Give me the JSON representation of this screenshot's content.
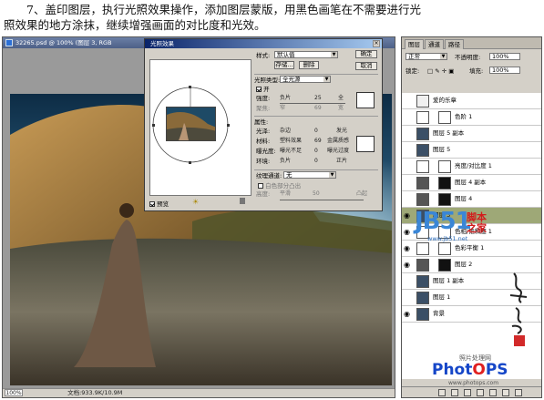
{
  "instruction": {
    "line1": "7、盖印图层，执行光照效果操作，添加图层蒙版，用黑色画笔在不需要进行光",
    "line2": "照效果的地方涂抹，继续增强画面的对比度和光效。"
  },
  "document": {
    "title": "32265.psd @ 100% (图层 3, RGB",
    "zoom": "100%",
    "doc_label": "文档:933.9K/10.9M"
  },
  "dialog": {
    "title": "光照效果",
    "ok": "确定",
    "cancel": "取消",
    "style_label": "样式:",
    "style_value": "默认值",
    "save": "存储...",
    "delete": "删除",
    "light_type_label": "光照类型:",
    "light_type_value": "全光源",
    "on_label": "开",
    "intensity_label": "强度:",
    "intensity_min": "负片",
    "intensity_value": "25",
    "intensity_max": "全",
    "focus_label": "聚焦:",
    "focus_min": "窄",
    "focus_value": "69",
    "focus_max": "宽",
    "properties_label": "属性:",
    "gloss_label": "光泽:",
    "gloss_min": "杂边",
    "gloss_value": "0",
    "gloss_max": "发光",
    "material_label": "材料:",
    "material_min": "塑料效果",
    "material_value": "69",
    "material_max": "金属质感",
    "exposure_label": "曝光度:",
    "exposure_min": "曝光不足",
    "exposure_value": "0",
    "exposure_max": "曝光过度",
    "ambience_label": "环境:",
    "ambience_min": "负片",
    "ambience_value": "0",
    "ambience_max": "正片",
    "texture_label": "纹理通道:",
    "texture_value": "无",
    "white_high_label": "白色部分凸出",
    "height_label": "高度:",
    "height_min": "平滑",
    "height_value": "50",
    "height_max": "凸起",
    "preview_label": "预览"
  },
  "layers_panel": {
    "tabs": [
      "图层",
      "通道",
      "路径"
    ],
    "blend_mode": "正常",
    "opacity_label": "不透明度:",
    "opacity_value": "100%",
    "lock_label": "锁定:",
    "fill_label": "填充:",
    "fill_value": "100%",
    "layers": [
      {
        "name": "爱的乐章",
        "type": "text",
        "visible": false,
        "selected": false
      },
      {
        "name": "色阶 1",
        "type": "adjust",
        "visible": false,
        "selected": false
      },
      {
        "name": "图层 5 副本",
        "type": "image",
        "visible": false,
        "selected": false
      },
      {
        "name": "图层 5",
        "type": "image",
        "visible": false,
        "selected": false
      },
      {
        "name": "亮度/对比度 1",
        "type": "adjust",
        "visible": false,
        "selected": false
      },
      {
        "name": "图层 4 副本",
        "type": "mask",
        "visible": false,
        "selected": false
      },
      {
        "name": "图层 4",
        "type": "mask",
        "visible": false,
        "selected": false
      },
      {
        "name": "图层 3",
        "type": "image",
        "visible": true,
        "selected": true
      },
      {
        "name": "色相/饱和度 1",
        "type": "adjust",
        "visible": true,
        "selected": false
      },
      {
        "name": "色彩平衡 1",
        "type": "adjust",
        "visible": true,
        "selected": false
      },
      {
        "name": "图层 2",
        "type": "mask",
        "visible": true,
        "selected": false
      },
      {
        "name": "图层 1 副本",
        "type": "image",
        "visible": false,
        "selected": false
      },
      {
        "name": "图层 1",
        "type": "image",
        "visible": false,
        "selected": false
      },
      {
        "name": "背景",
        "type": "image",
        "visible": true,
        "selected": false
      }
    ]
  },
  "watermarks": {
    "jb51_big": "JB51",
    "jb51_cn1": "脚本",
    "jb51_cn2": "之家",
    "jb51_url": "www.jb51.net",
    "photops_sub": "照片处理网",
    "photops_logo_a": "Phot",
    "photops_logo_b": "O",
    "photops_logo_c": "PS",
    "photops_url": "www.photops.com"
  },
  "colors": {
    "selected_layer": "#9ea877",
    "panel_bg": "#d4d0c8",
    "titlebar": "#0a246a"
  }
}
